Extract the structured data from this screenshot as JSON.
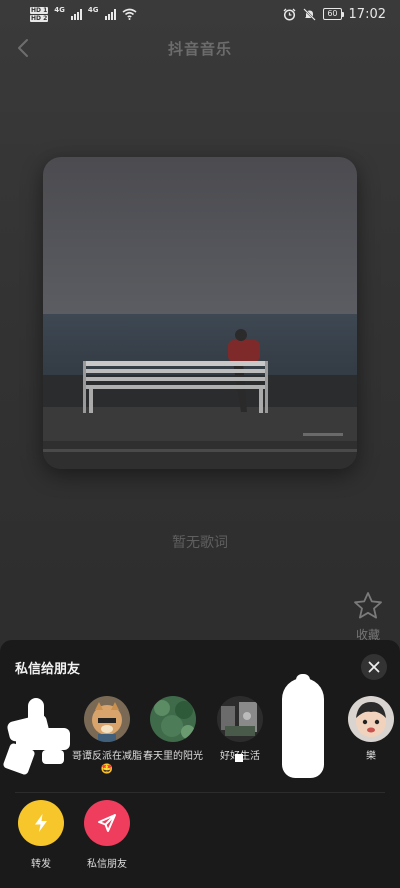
{
  "status_bar": {
    "hd1": "HD 1",
    "hd2": "HD 2",
    "network1": "4G",
    "network2": "4G",
    "battery": "60",
    "time": "17:02",
    "icons": [
      "signal-icon",
      "wifi-icon",
      "alarm-icon",
      "mute-bell-icon",
      "battery-icon"
    ]
  },
  "header": {
    "title": "抖音音乐",
    "back_icon": "chevron-left-icon"
  },
  "player": {
    "lyrics_placeholder": "暂无歌词",
    "favorite_label": "收藏",
    "favorite_icon": "star-icon"
  },
  "share_sheet": {
    "title": "私信给朋友",
    "close_icon": "close-icon",
    "friends": [
      {
        "name": ""
      },
      {
        "name": "哥谭反派在减脂🤩"
      },
      {
        "name": "春天里的阳光"
      },
      {
        "name": "好好生活"
      },
      {
        "name": ""
      },
      {
        "name": "樂"
      }
    ],
    "actions": [
      {
        "label": "转发",
        "icon": "lightning-icon",
        "color": "#f6c62a"
      },
      {
        "label": "私信朋友",
        "icon": "send-icon",
        "color": "#ee3d5d"
      }
    ]
  }
}
